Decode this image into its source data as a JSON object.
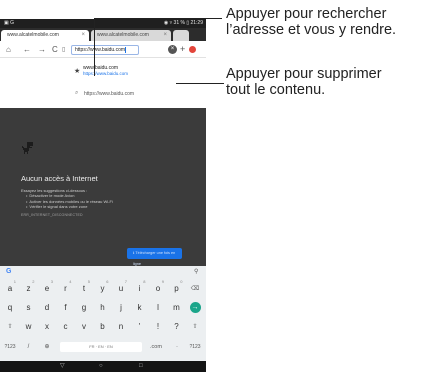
{
  "status_bar": {
    "left": "▣  G",
    "right": "◉  ▿  31 % ▯  21:29"
  },
  "tabs": [
    {
      "label": "www.alcatelmobile.com"
    },
    {
      "label": "www.alcatelmobile.com"
    }
  ],
  "toolbar": {
    "home": "⌂",
    "back": "←",
    "forward": "→",
    "reload": "C",
    "page_icon": "▯",
    "url": "https://www.baidu.com",
    "clear": "×",
    "new_tab": "+"
  },
  "suggestions": [
    {
      "icon": "star-icon",
      "glyph": "★",
      "title": "www.baidu.com",
      "url": "https://www.baidu.com"
    },
    {
      "icon": "search-icon",
      "glyph": "⌕",
      "text": "https://www.baidu.com"
    }
  ],
  "offline": {
    "title": "Aucun accès à Internet",
    "intro": "Essayez les suggestions ci-dessous :",
    "items": [
      "Désactiver le mode Avion",
      "Activer les données mobiles ou le réseau Wi-Fi",
      "Vérifier le signal dans votre zone"
    ],
    "code": "ERR_INTERNET_DISCONNECTED",
    "download_button": "⭳  Télécharger une fois en ligne"
  },
  "keyboard": {
    "logo": "G",
    "mic": "🎙",
    "row1": [
      {
        "k": "a",
        "h": "1"
      },
      {
        "k": "z",
        "h": "2"
      },
      {
        "k": "e",
        "h": "3"
      },
      {
        "k": "r",
        "h": "4"
      },
      {
        "k": "t",
        "h": "5"
      },
      {
        "k": "y",
        "h": "6"
      },
      {
        "k": "u",
        "h": "7"
      },
      {
        "k": "i",
        "h": "8"
      },
      {
        "k": "o",
        "h": "9"
      },
      {
        "k": "p",
        "h": "0"
      },
      {
        "k": "⌫",
        "h": ""
      }
    ],
    "row2": [
      "q",
      "s",
      "d",
      "f",
      "g",
      "h",
      "j",
      "k",
      "l",
      "m",
      "→"
    ],
    "row3": [
      "⇧",
      "w",
      "x",
      "c",
      "v",
      "b",
      "n",
      "'",
      "!",
      "?",
      "⇧"
    ],
    "row4": {
      "sym": "?123",
      "slash": "/",
      "globe": "⊕",
      "space": "FR · EN · EN",
      "com": ".com",
      "period": "·",
      "sym2": "?123"
    }
  },
  "navbar": {
    "back": "▽",
    "home": "○",
    "recent": "□"
  },
  "callouts": {
    "search": [
      "Appuyer pour rechercher",
      "l’adresse et vous y rendre."
    ],
    "delete": [
      "Appuyer pour supprimer",
      "tout le contenu."
    ]
  }
}
